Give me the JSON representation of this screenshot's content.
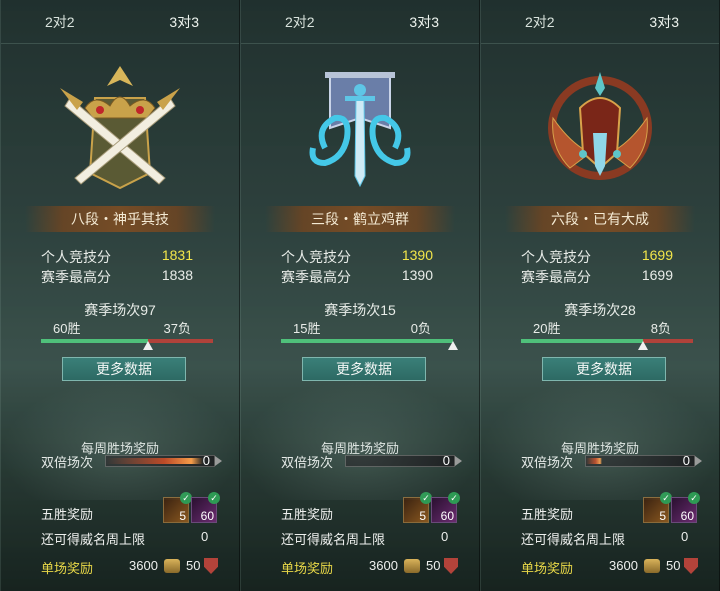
{
  "tabs": [
    "2对2",
    "3对3"
  ],
  "labels": {
    "personal_score": "个人竞技分",
    "season_high": "赛季最高分",
    "more_data": "更多数据",
    "weekly_reward": "每周胜场奖励",
    "double_matches": "双倍场次",
    "five_win_reward": "五胜奖励",
    "fame_limit": "还可得威名周上限",
    "single_reward": "单场奖励"
  },
  "panels": [
    {
      "rank": "八段・神乎其技",
      "emblem_icon": "crossed-blades-crown-icon",
      "score": "1831",
      "season_high": "1838",
      "season_matches": "赛季场次97",
      "wins": "60胜",
      "losses": "37负",
      "win_ratio": 0.62,
      "double_count": "0",
      "double_glow": 0.9,
      "items": [
        {
          "count": "5"
        },
        {
          "count": "60"
        }
      ],
      "fame_limit_value": "0",
      "reward_coin": "3600",
      "reward_fame": "50"
    },
    {
      "rank": "三段・鹤立鸡群",
      "emblem_icon": "banner-sword-dragon-icon",
      "score": "1390",
      "season_high": "1390",
      "season_matches": "赛季场次15",
      "wins": "15胜",
      "losses": "0负",
      "win_ratio": 1.0,
      "double_count": "0",
      "double_glow": 0.0,
      "items": [
        {
          "count": "5"
        },
        {
          "count": "60"
        }
      ],
      "fame_limit_value": "0",
      "reward_coin": "3600",
      "reward_fame": "50"
    },
    {
      "rank": "六段・已有大成",
      "emblem_icon": "ornate-helm-wings-icon",
      "score": "1699",
      "season_high": "1699",
      "season_matches": "赛季场次28",
      "wins": "20胜",
      "losses": "8负",
      "win_ratio": 0.71,
      "double_count": "0",
      "double_glow": 0.15,
      "items": [
        {
          "count": "5"
        },
        {
          "count": "60"
        }
      ],
      "fame_limit_value": "0",
      "reward_coin": "3600",
      "reward_fame": "50"
    }
  ],
  "colors": {
    "score_highlight": "#f2e54a",
    "win_bar": "#4fc07a",
    "loss_bar": "#b0423a",
    "reward_label": "#e8d848"
  }
}
